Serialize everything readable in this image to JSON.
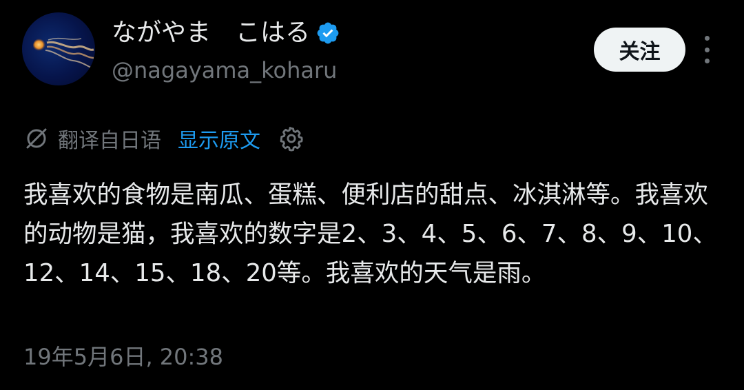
{
  "author": {
    "display_name": "ながやま　こはる",
    "handle": "@nagayama_koharu",
    "avatar_icon": "jellyfish-avatar",
    "verified_icon": "verified-badge-icon"
  },
  "actions": {
    "follow_label": "关注",
    "more_icon": "more-dots-icon"
  },
  "translation": {
    "translated_label": "翻译自日语",
    "show_original_label": "显示原文",
    "translate_icon": "translate-off-icon",
    "settings_icon": "gear-icon"
  },
  "tweet": {
    "text": "我喜欢的食物是南瓜、蛋糕、便利店的甜点、冰淇淋等。我喜欢的动物是猫，我喜欢的数字是2、3、4、5、6、7、8、9、10、12、14、15、18、20等。我喜欢的天气是雨。",
    "timestamp": "19年5月6日, 20:38"
  },
  "colors": {
    "background": "#000000",
    "text_primary": "#e7e9ea",
    "text_secondary": "#71767b",
    "link": "#1d9bf0",
    "verified": "#1d9bf0",
    "follow_bg": "#eff3f4"
  }
}
